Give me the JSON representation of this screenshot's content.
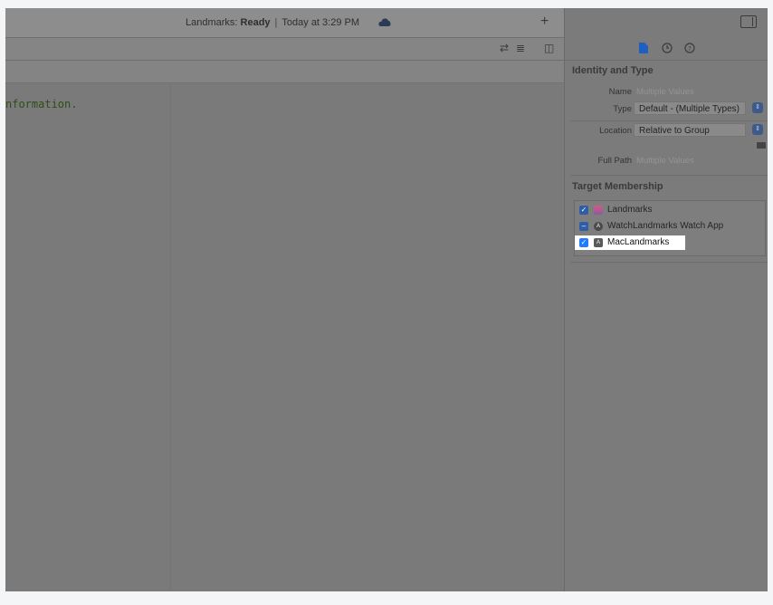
{
  "toolbar": {
    "status_project": "Landmarks:",
    "status_state": "Ready",
    "status_separator": "|",
    "status_time": "Today at 3:29 PM",
    "cloud_icon": "cloud-icon",
    "add_icon": "+"
  },
  "tabbar": {
    "icons": [
      "⇄",
      "≣",
      "◫"
    ]
  },
  "editor": {
    "code_line": "nformation."
  },
  "inspector": {
    "tabs": [
      "file-icon",
      "clock-icon",
      "help-icon"
    ],
    "identity": {
      "title": "Identity and Type",
      "name_label": "Name",
      "name_placeholder": "Multiple Values",
      "type_label": "Type",
      "type_value": "Default - (Multiple Types)",
      "location_label": "Location",
      "location_value": "Relative to Group",
      "fullpath_label": "Full Path",
      "fullpath_placeholder": "Multiple Values"
    },
    "membership": {
      "title": "Target Membership",
      "items": [
        {
          "label": "Landmarks",
          "state": "checked"
        },
        {
          "label": "WatchLandmarks Watch App",
          "state": "mixed"
        },
        {
          "label": "MacLandmarks",
          "state": "checked"
        }
      ]
    }
  },
  "colors": {
    "accent": "#1f7bff",
    "dim_overlay": "#7a7a7a"
  }
}
